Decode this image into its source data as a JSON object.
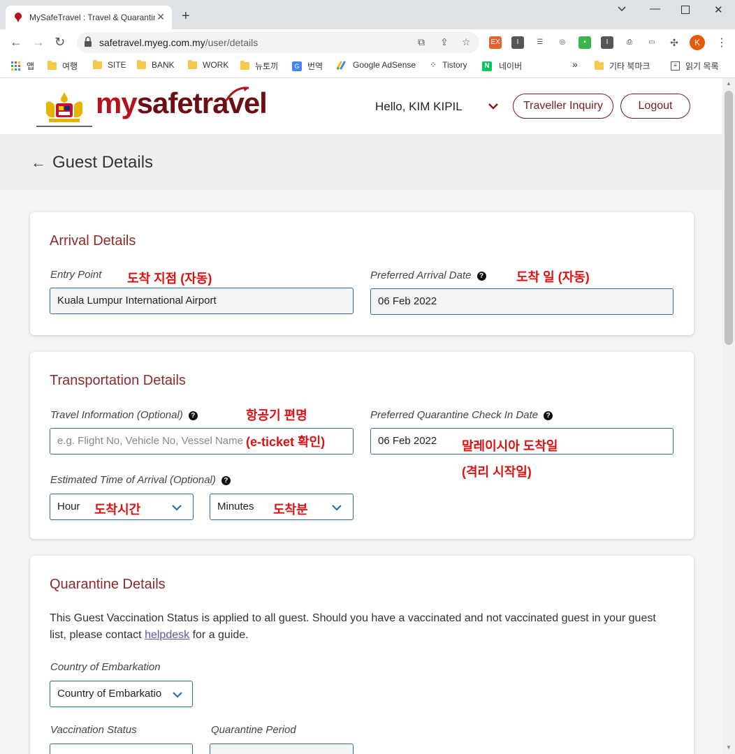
{
  "browser": {
    "tab_title": "MySafeTravel : Travel & Quarantine",
    "url_host": "safetravel.myeg.com.my",
    "url_path": "/user/details",
    "profile_initial": "K",
    "bookmarks": [
      "앱",
      "여행",
      "SITE",
      "BANK",
      "WORK",
      "뉴토끼",
      "번역",
      "Google AdSense",
      "Tistory",
      "네이버",
      "»",
      "기타 북마크",
      "읽기 목록"
    ]
  },
  "header": {
    "logo_part1": "my",
    "logo_part2": "safetravel",
    "greeting": "Hello, KIM KIPIL",
    "inquiry_button": "Traveller Inquiry",
    "logout_button": "Logout",
    "brand_color": "#b5121b"
  },
  "page": {
    "title": "Guest Details"
  },
  "arrival": {
    "title": "Arrival Details",
    "entry_label": "Entry Point",
    "entry_value": "Kuala Lumpur International Airport",
    "date_label": "Preferred Arrival Date",
    "date_value": "06 Feb 2022",
    "note_entry": "도착 지점 (자동)",
    "note_date": "도착 일 (자동)"
  },
  "transport": {
    "title": "Transportation Details",
    "travel_label": "Travel Information (Optional)",
    "travel_placeholder": "e.g. Flight No, Vehicle No, Vessel Name",
    "checkin_label": "Preferred Quarantine Check In Date",
    "checkin_value": "06 Feb 2022",
    "eta_label": "Estimated Time of Arrival (Optional)",
    "hour_value": "Hour",
    "minutes_value": "Minutes",
    "note_flight": "항공기 편명",
    "note_eticket": "(e-ticket 확인)",
    "note_malaysia": "말레이시아 도착일",
    "note_quarantine": "(격리 시작일)",
    "note_hour": "도착시간",
    "note_minutes": "도착분"
  },
  "quarantine": {
    "title": "Quarantine Details",
    "desc_before": "This Guest Vaccination Status is applied to all guest. Should you have a vaccinated and not vaccinated guest in your guest list, please contact ",
    "desc_link": "helpdesk",
    "desc_after": " for a guide.",
    "embark_label": "Country of Embarkation",
    "embark_value": "Country of Embarkatio",
    "vacc_label": "Vaccination Status",
    "period_label": "Quarantine Period"
  }
}
